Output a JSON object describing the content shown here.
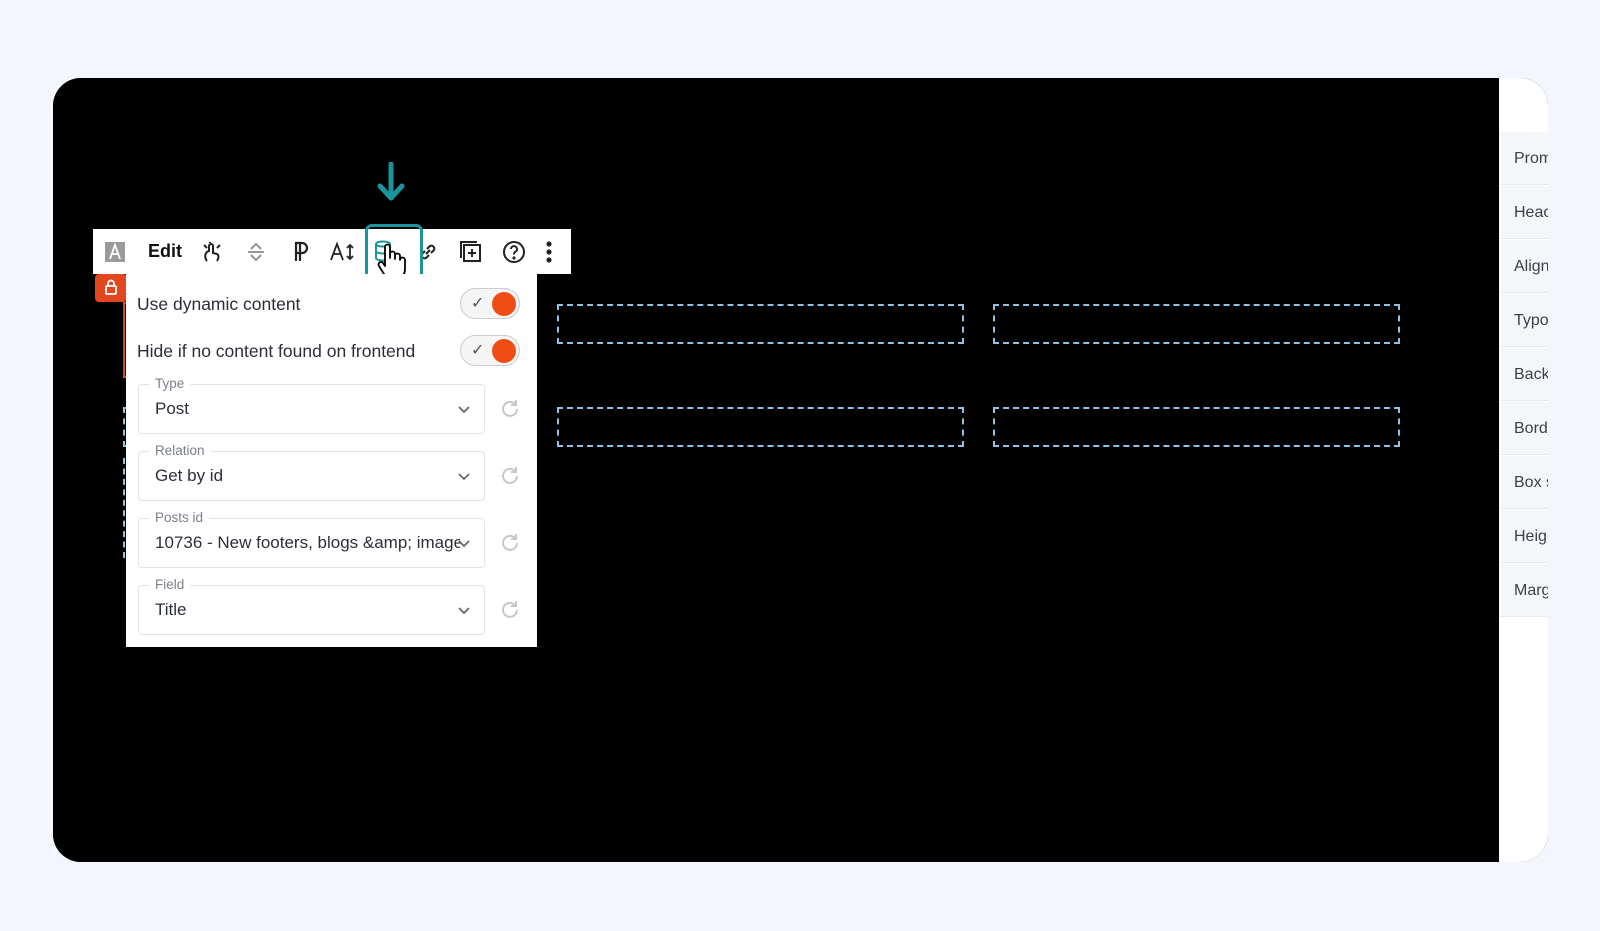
{
  "toolbar": {
    "edit_label": "Edit",
    "icons": [
      "text-element-icon",
      "edit-button",
      "interactions-icon",
      "align-icon",
      "paragraph-icon",
      "typography-icon",
      "dynamic-data-icon",
      "link-icon",
      "add-block-icon",
      "help-icon",
      "more-options-icon"
    ],
    "active_item": "dynamic-data-icon"
  },
  "popup": {
    "use_dynamic_label": "Use dynamic content",
    "use_dynamic_on": true,
    "hide_label": "Hide if no content found on frontend",
    "hide_on": true,
    "fields": [
      {
        "label": "Type",
        "value": "Post"
      },
      {
        "label": "Relation",
        "value": "Get by id"
      },
      {
        "label": "Posts id",
        "value": "10736 - New footers, blogs &amp; image ..."
      },
      {
        "label": "Field",
        "value": "Title"
      }
    ]
  },
  "sidebar": {
    "items": [
      {
        "label": "Prom"
      },
      {
        "label": "Heac"
      },
      {
        "label": "Align"
      },
      {
        "label": "Typo"
      },
      {
        "label": "Back"
      },
      {
        "label": "Bord"
      },
      {
        "label": "Box s"
      },
      {
        "label": "Heig"
      },
      {
        "label": "Marg"
      }
    ]
  },
  "colors": {
    "accent_teal": "#1a95a0",
    "toggle_orange": "#f04d12",
    "selection_red": "#e2471f",
    "dash_blue": "#8fc3e6"
  }
}
